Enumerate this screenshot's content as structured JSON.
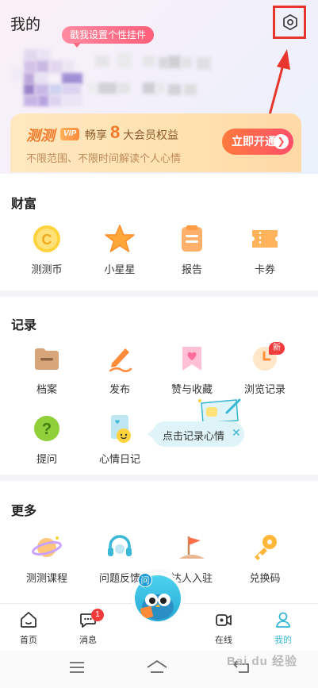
{
  "header": {
    "title": "我的",
    "pendant_label": "戳我设置个性挂件",
    "settings_icon": "gear-icon"
  },
  "vip": {
    "brand": "测测",
    "tag": "VIP",
    "enjoy": "畅享",
    "count": "8",
    "rights": "大会员权益",
    "desc": "不限范围、不限时间解读个人心情",
    "button": "立即开通"
  },
  "wealth": {
    "title": "财富",
    "items": [
      {
        "label": "测测币",
        "icon": "coin-icon"
      },
      {
        "label": "小星星",
        "icon": "star-icon"
      },
      {
        "label": "报告",
        "icon": "report-icon"
      },
      {
        "label": "卡券",
        "icon": "ticket-icon"
      }
    ]
  },
  "records": {
    "title": "记录",
    "items": [
      {
        "label": "档案",
        "icon": "folder-icon"
      },
      {
        "label": "发布",
        "icon": "pen-icon"
      },
      {
        "label": "赞与收藏",
        "icon": "heart-bookmark-icon"
      },
      {
        "label": "浏览记录",
        "icon": "clock-icon"
      },
      {
        "label": "提问",
        "icon": "question-icon"
      },
      {
        "label": "心情日记",
        "icon": "diary-icon"
      }
    ],
    "new_badge": "新",
    "tooltip": "点击记录心情",
    "tooltip_close": "✕"
  },
  "more": {
    "title": "更多",
    "items": [
      {
        "label": "测测课程",
        "icon": "planet-icon"
      },
      {
        "label": "问题反馈",
        "icon": "headset-icon"
      },
      {
        "label": "达人入驻",
        "icon": "flag-icon"
      },
      {
        "label": "兑换码",
        "icon": "key-icon"
      }
    ]
  },
  "tabbar": {
    "items": [
      {
        "label": "首页",
        "icon": "home-icon"
      },
      {
        "label": "消息",
        "icon": "message-icon"
      },
      {
        "label": "在线",
        "icon": "video-icon"
      },
      {
        "label": "我的",
        "icon": "user-icon"
      }
    ],
    "message_count": "1",
    "center_label": "问"
  },
  "watermark": "Bai du 经验",
  "colors": {
    "accent": "#39b7d6",
    "vip_orange": "#f07a2a",
    "annotation_red": "#e8362d"
  }
}
